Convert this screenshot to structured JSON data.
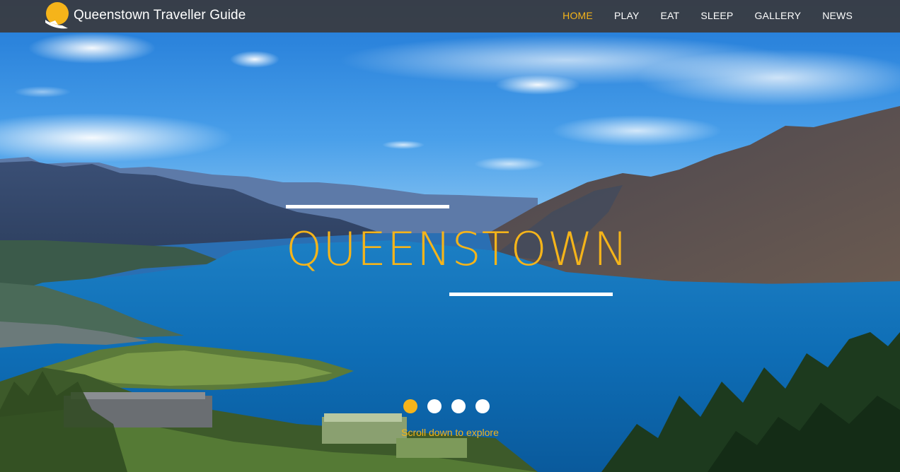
{
  "brand": {
    "logo_icon": "sun-logo-icon",
    "name": "Queenstown Traveller Guide"
  },
  "nav": {
    "items": [
      {
        "label": "HOME",
        "active": true
      },
      {
        "label": "PLAY",
        "active": false
      },
      {
        "label": "EAT",
        "active": false
      },
      {
        "label": "SLEEP",
        "active": false
      },
      {
        "label": "GALLERY",
        "active": false
      },
      {
        "label": "NEWS",
        "active": false
      }
    ]
  },
  "hero": {
    "title": "QUEENSTOWN",
    "slides": {
      "count": 4,
      "active_index": 0
    },
    "explore_text": "Scroll down to explore"
  },
  "colors": {
    "accent": "#f5b41a",
    "navbar": "#3a3a3e",
    "text_light": "#ffffff"
  }
}
